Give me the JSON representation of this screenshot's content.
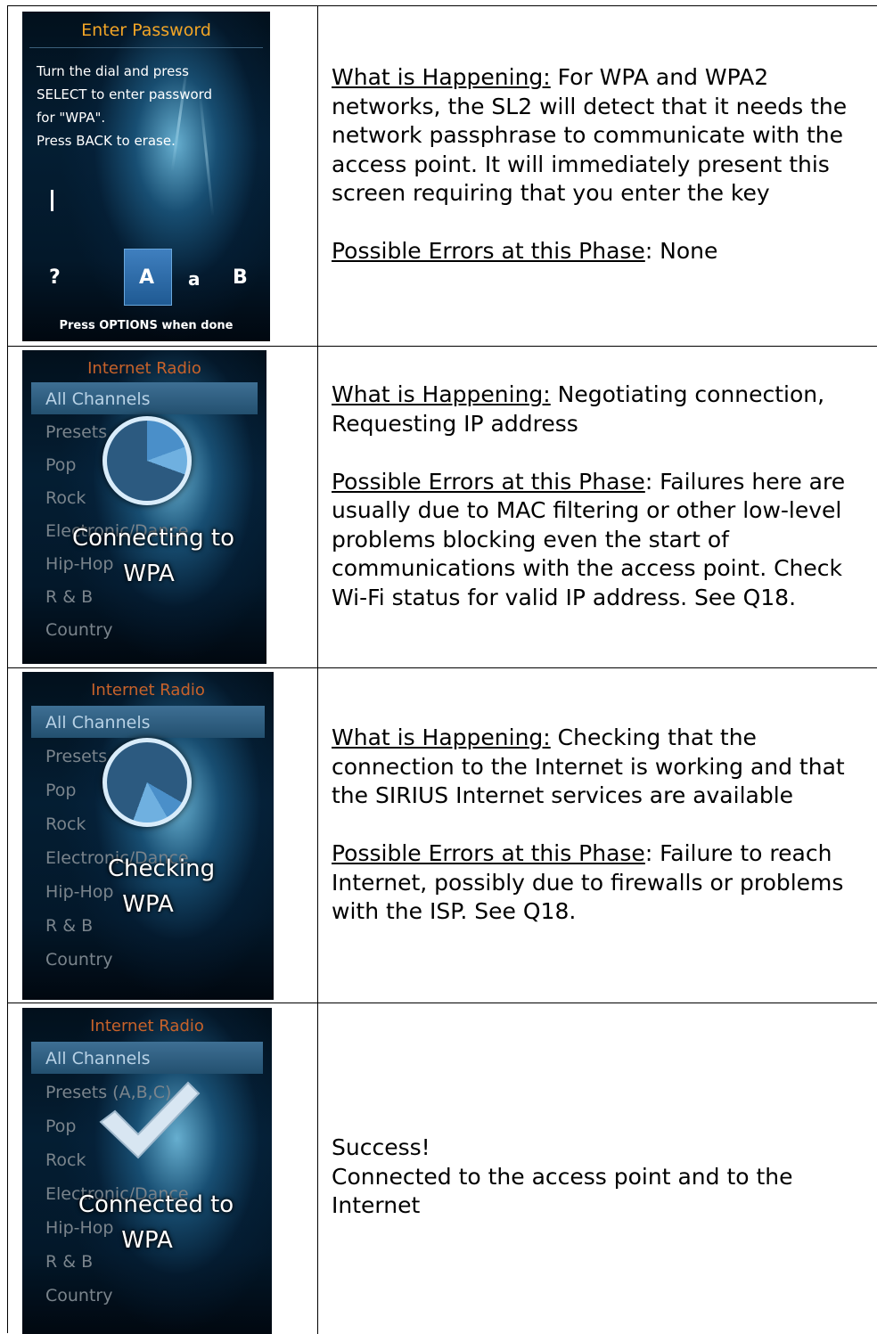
{
  "rows": [
    {
      "screen": {
        "title": "Enter Password",
        "instructions": "Turn the dial and press\nSELECT to enter password\nfor \"WPA\".\nPress BACK to erase.",
        "chars": [
          "?",
          "A",
          "a",
          "B"
        ],
        "footer": "Press OPTIONS when done"
      },
      "happening_label": "What is Happening:",
      "happening_text": " For WPA and WPA2 networks, the SL2 will detect that it needs the network passphrase to communicate with the access point.  It will immediately present this screen requiring that you enter the key",
      "errors_label": "Possible Errors at this Phase",
      "errors_text": ": None"
    },
    {
      "screen": {
        "title": "Internet Radio",
        "menu": [
          "All Channels",
          "Presets",
          "Pop",
          "Rock",
          "Electronic/Dance",
          "Hip-Hop",
          "R & B",
          "Country"
        ],
        "overlay_line1": "Connecting to",
        "overlay_line2": "WPA"
      },
      "happening_label": "What is Happening:",
      "happening_text": " Negotiating connection, Requesting IP address",
      "errors_label": "Possible Errors at this Phase",
      "errors_text": ": Failures here are usually due to MAC filtering or other low-level problems blocking even the start of communications with the access point. Check Wi-Fi status for valid IP address.  See Q18."
    },
    {
      "screen": {
        "title": "Internet Radio",
        "menu": [
          "All Channels",
          "Presets",
          "Pop",
          "Rock",
          "Electronic/Dance",
          "Hip-Hop",
          "R & B",
          "Country"
        ],
        "overlay_line1": "Checking",
        "overlay_line2": "WPA"
      },
      "happening_label": "What is Happening:",
      "happening_text": " Checking that the connection to the Internet is working and that the SIRIUS Internet services are available",
      "errors_label": "Possible Errors at this Phase",
      "errors_text": ": Failure to reach Internet, possibly due to firewalls or problems with the ISP.  See Q18."
    },
    {
      "screen": {
        "title": "Internet Radio",
        "menu": [
          "All Channels",
          "Presets (A,B,C)",
          "Pop",
          "Rock",
          "Electronic/Dance",
          "Hip-Hop",
          "R & B",
          "Country"
        ],
        "overlay_line1": "Connected to",
        "overlay_line2": "WPA"
      },
      "success_title": "Success!",
      "success_text": "Connected to the access point and to the Internet"
    }
  ]
}
